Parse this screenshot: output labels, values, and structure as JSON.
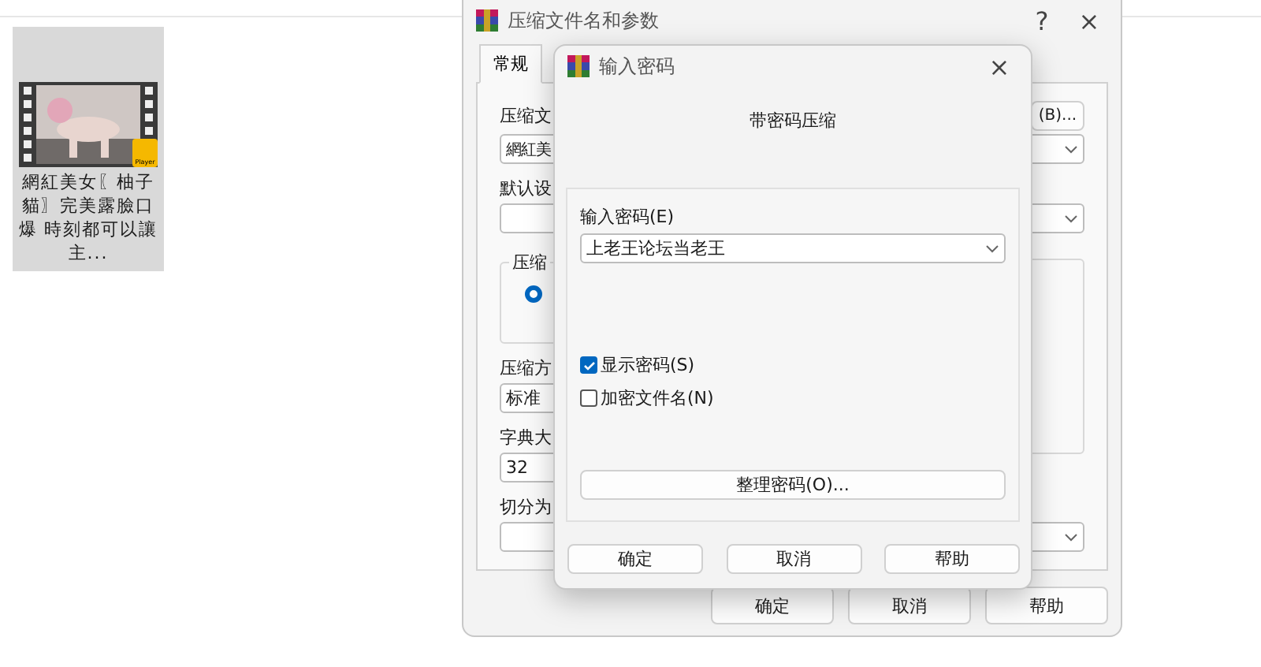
{
  "file_tile": {
    "name": "網紅美女〖柚子貓〗完美露臉口爆 時刻都可以讓主...",
    "badge": "Player",
    "selected": true
  },
  "main_dialog": {
    "title": "压缩文件名和参数",
    "help_button": "?",
    "close_button": "×",
    "tabs": [
      {
        "label": "常规",
        "selected": true
      }
    ],
    "archive_name": {
      "label": "压缩文",
      "value": "網紅美",
      "browse_button": "(B)..."
    },
    "default_profile": {
      "label": "默认设"
    },
    "format_group": {
      "label": "压缩",
      "radio_selected": true
    },
    "method": {
      "label": "压缩方",
      "value": "标准"
    },
    "dictionary": {
      "label": "字典大",
      "value": "32"
    },
    "split": {
      "label": "切分为"
    },
    "buttons": [
      "确定",
      "取消",
      "帮助"
    ]
  },
  "password_dialog": {
    "title": "输入密码",
    "close_button": "×",
    "heading": "带密码压缩",
    "password": {
      "label": "输入密码(E)",
      "value": "上老王论坛当老王"
    },
    "options": [
      {
        "label": "显示密码(S)",
        "checked": true
      },
      {
        "label": "加密文件名(N)",
        "checked": false
      }
    ],
    "organize_button": "整理密码(O)...",
    "buttons": [
      "确定",
      "取消",
      "帮助"
    ]
  }
}
